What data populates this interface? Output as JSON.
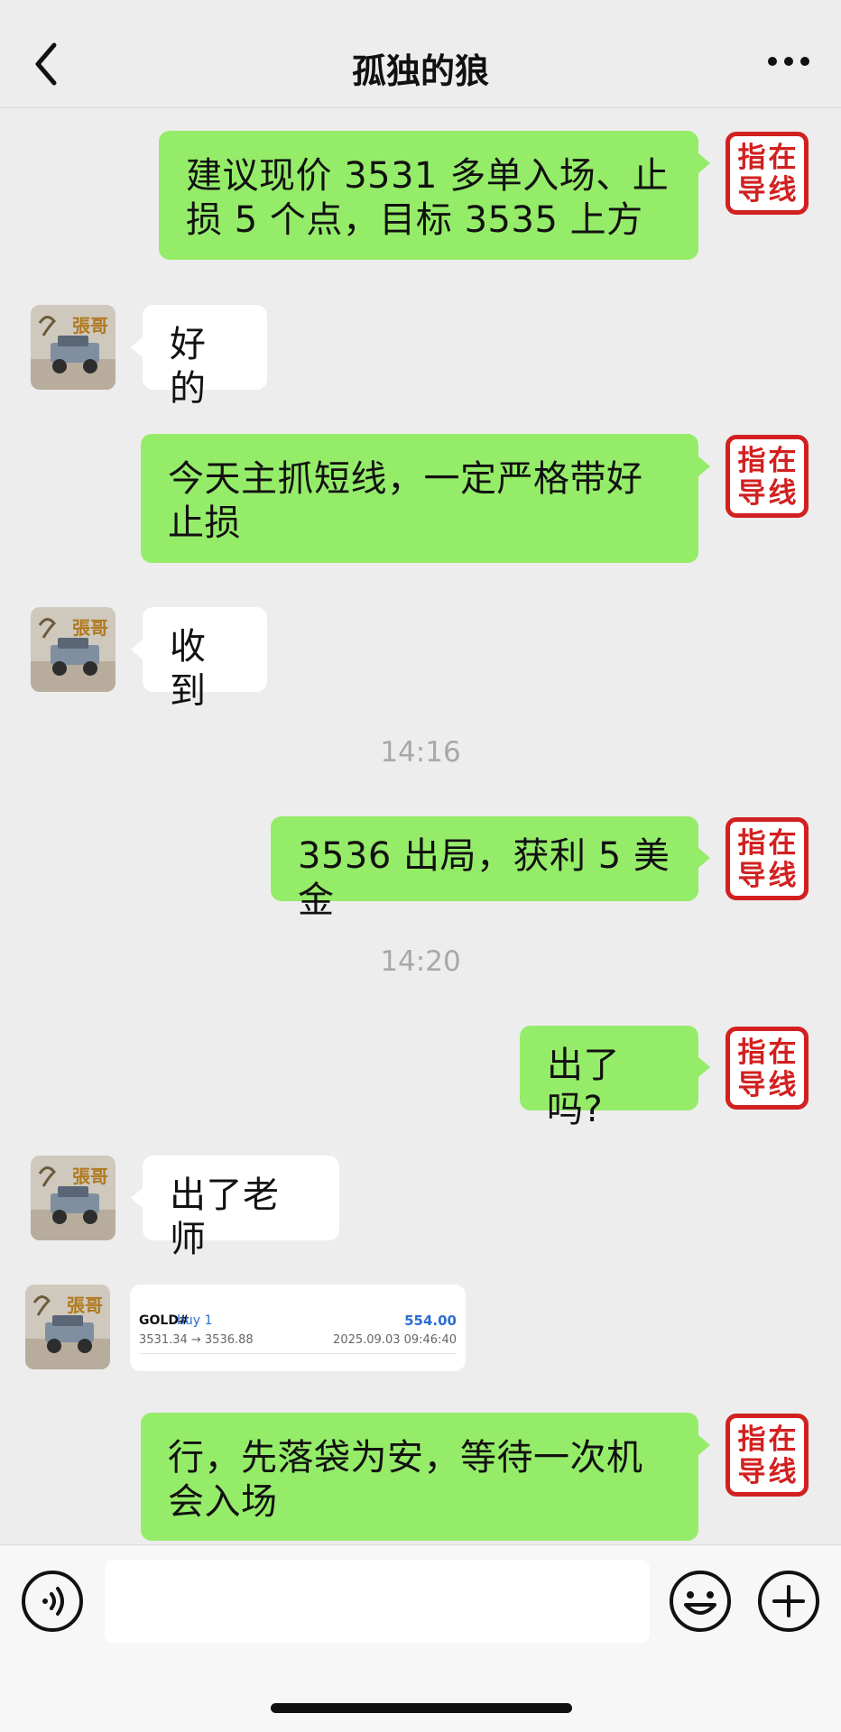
{
  "header": {
    "title": "孤独的狼"
  },
  "stamp": {
    "chars": [
      "指",
      "在",
      "导",
      "线"
    ]
  },
  "messages": [
    {
      "from": "me",
      "text": "建议现价 3531 多单入场、止损 5 个点，目标 3535 上方"
    },
    {
      "from": "other",
      "text": "好的"
    },
    {
      "from": "me",
      "text": "今天主抓短线，一定严格带好止损"
    },
    {
      "from": "other",
      "text": "收到"
    },
    {
      "type": "time",
      "text": "14:16"
    },
    {
      "from": "me",
      "text": "3536 出局，获利 5 美金"
    },
    {
      "type": "time",
      "text": "14:20"
    },
    {
      "from": "me",
      "text": "出了吗?"
    },
    {
      "from": "other",
      "text": "出了老师"
    },
    {
      "from": "other",
      "type": "trade_card"
    },
    {
      "from": "me",
      "text": "行，先落袋为安，等待一次机会入场"
    }
  ],
  "trade_card": {
    "symbol": "GOLD#",
    "side": "buy 1",
    "profit": "554.00",
    "prices": "3531.34 → 3536.88",
    "datetime": "2025.09.03 09:46:40"
  },
  "avatar": {
    "label": "張哥"
  },
  "footer": {
    "input_value": ""
  },
  "colors": {
    "background": "#ededed",
    "me_bubble": "#95ec69",
    "other_bubble": "#ffffff",
    "stamp_red": "#d22020",
    "timestamp": "#a8a8a8",
    "trade_blue": "#2a6fd1"
  },
  "icons": [
    "back-arrow-icon",
    "more-dots-icon",
    "voice-icon",
    "emoji-icon",
    "plus-icon"
  ]
}
